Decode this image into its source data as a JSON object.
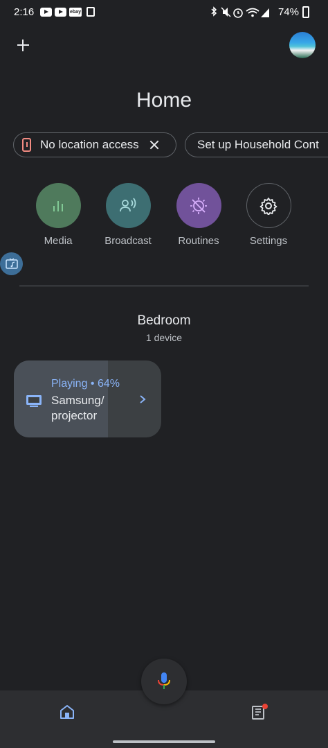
{
  "status_bar": {
    "time": "2:16",
    "battery": "74%"
  },
  "header": {
    "title": "Home"
  },
  "chips": [
    {
      "label": "No location access"
    },
    {
      "label": "Set up Household Cont"
    }
  ],
  "actions": [
    {
      "label": "Media",
      "icon": "bars-icon",
      "color": "#4f7a5c"
    },
    {
      "label": "Broadcast",
      "icon": "broadcast-icon",
      "color": "#3d6e72"
    },
    {
      "label": "Routines",
      "icon": "routines-icon",
      "color": "#71529a"
    },
    {
      "label": "Settings",
      "icon": "gear-icon"
    }
  ],
  "room": {
    "name": "Bedroom",
    "device_count": "1 device"
  },
  "device": {
    "status": "Playing • 64%",
    "name": "Samsung/ projector",
    "progress": 0.64
  },
  "colors": {
    "accent": "#8ab4f8",
    "background": "#202124"
  }
}
